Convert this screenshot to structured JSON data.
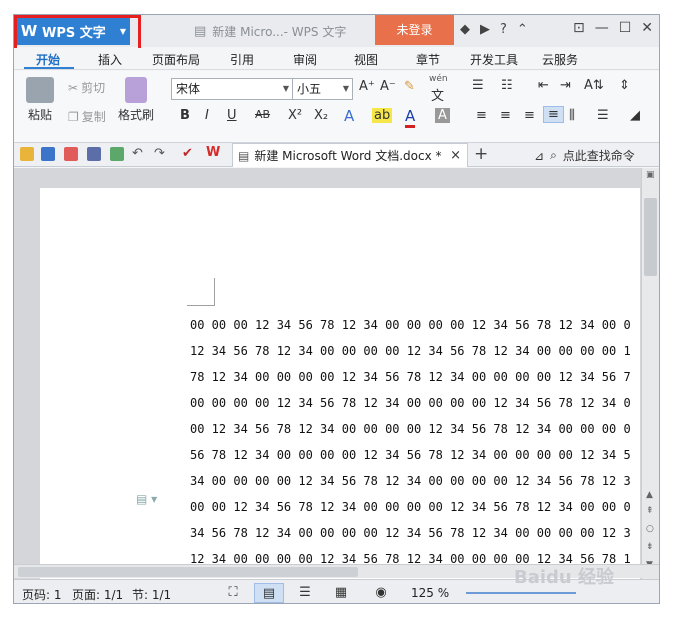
{
  "titlebar": {
    "app_name": "WPS 文字",
    "doc_title": "新建 Micro...- WPS 文字",
    "login": "未登录",
    "help": "?"
  },
  "tabs": [
    "开始",
    "插入",
    "页面布局",
    "引用",
    "审阅",
    "视图",
    "章节",
    "开发工具",
    "云服务"
  ],
  "ribbon": {
    "paste": "粘贴",
    "cut": "剪切",
    "copy": "复制",
    "format_painter": "格式刷",
    "font_name": "宋体",
    "font_size": "小五",
    "bold": "B",
    "italic": "I",
    "underline": "U",
    "strike": "AB",
    "superscript": "X²",
    "subscript": "X₂",
    "font_color_a": "A",
    "grow_font": "A⁺",
    "shrink_font": "A⁻",
    "pinyin": "wén",
    "pinyin_char": "文"
  },
  "qbar": {
    "doc_tab": "新建 Microsoft Word 文档.docx *",
    "close": "×",
    "plus": "+",
    "search": "点此查找命令"
  },
  "document": {
    "lines": [
      "00 00 00 12 34 56 78 12 34 00 00 00 00 12 34 56 78 12 34 00 0",
      "12 34 56 78 12 34 00 00 00 00 12 34 56 78 12 34 00 00 00 00 1",
      "78 12 34 00 00 00 00 12 34 56 78 12 34 00 00 00 00 12 34 56 7",
      "00 00 00 00 12 34 56 78 12 34 00 00 00 00 12 34 56 78 12 34 0",
      "00 12 34 56 78 12 34 00 00 00 00 12 34 56 78 12 34 00 00 00 0",
      "56 78 12 34 00 00 00 00 12 34 56 78 12 34 00 00 00 00 12 34 5",
      "34 00 00 00 00 12 34 56 78 12 34 00 00 00 00 12 34 56 78 12 3",
      "00 00 12 34 56 78 12 34 00 00 00 00 12 34 56 78 12 34 00 00 0",
      "34 56 78 12 34 00 00 00 00 12 34 56 78 12 34 00 00 00 00 12 3",
      "12 34 00 00 00 00 12 34 56 78 12 34 00 00 00 00 12 34 56 78 1"
    ]
  },
  "status": {
    "page_num": "页码: 1",
    "pages": "页面: 1/1",
    "section": "节: 1/1",
    "zoom": "125 %"
  },
  "watermark": "Baidu 经验",
  "colors": {
    "app_blue": "#2f7fd3",
    "login_orange": "#e8704a",
    "highlight_red": "#e62020"
  }
}
